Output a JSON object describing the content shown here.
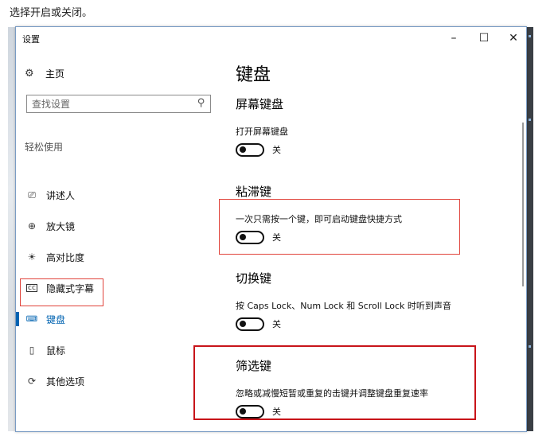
{
  "instruction": "选择开启或关闭。",
  "window": {
    "title": "设置",
    "controls": {
      "minimize": "–",
      "maximize": "☐",
      "close": "✕"
    }
  },
  "sidebar": {
    "home": {
      "label": "主页",
      "icon": "gear-icon"
    },
    "search": {
      "placeholder": "查找设置",
      "icon": "search-icon"
    },
    "section_heading": "轻松使用",
    "items": [
      {
        "label": "讲述人",
        "icon": "narrator-icon",
        "active": false
      },
      {
        "label": "放大镜",
        "icon": "magnifier-icon",
        "active": false
      },
      {
        "label": "高对比度",
        "icon": "contrast-icon",
        "active": false
      },
      {
        "label": "隐藏式字幕",
        "icon": "captions-icon",
        "active": false
      },
      {
        "label": "键盘",
        "icon": "keyboard-icon",
        "active": true
      },
      {
        "label": "鼠标",
        "icon": "mouse-icon",
        "active": false
      },
      {
        "label": "其他选项",
        "icon": "other-options-icon",
        "active": false
      }
    ]
  },
  "main": {
    "page_title": "键盘",
    "groups": [
      {
        "title": "屏幕键盘",
        "description": "打开屏幕键盘",
        "toggle_state": "关",
        "on": false
      },
      {
        "title": "粘滞键",
        "description": "一次只需按一个键，即可启动键盘快捷方式",
        "toggle_state": "关",
        "on": false
      },
      {
        "title": "切换键",
        "description": "按 Caps Lock、Num Lock 和 Scroll Lock 时听到声音",
        "toggle_state": "关",
        "on": false
      },
      {
        "title": "筛选键",
        "description": "忽略或减慢短暂或重复的击键并调整键盘重复速率",
        "toggle_state": "关",
        "on": false
      }
    ]
  },
  "colors": {
    "accent": "#0063b1",
    "highlight_box": "#e0423a"
  }
}
